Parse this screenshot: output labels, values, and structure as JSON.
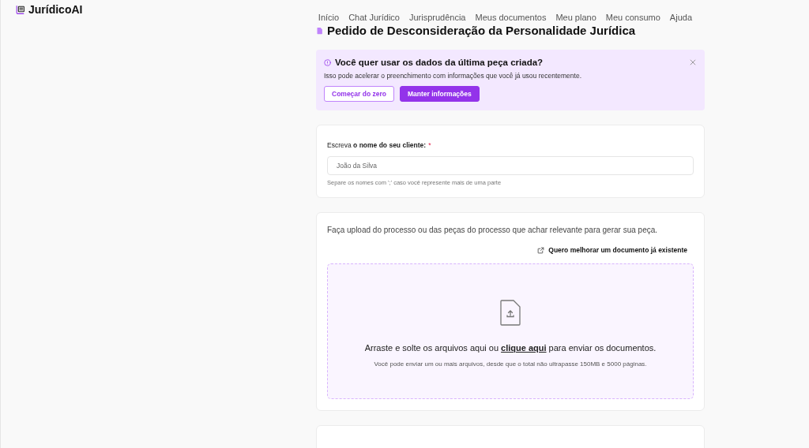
{
  "brand": {
    "name": "JurídicoAI"
  },
  "nav": [
    {
      "label": "Início"
    },
    {
      "label": "Chat Jurídico"
    },
    {
      "label": "Jurisprudência"
    },
    {
      "label": "Meus documentos"
    },
    {
      "label": "Meu plano"
    },
    {
      "label": "Meu consumo"
    },
    {
      "label": "Ajuda"
    }
  ],
  "page_title": "Pedido de Desconsideração da Personalidade Jurídica",
  "banner": {
    "title": "Você quer usar os dados da última peça criada?",
    "text": "Isso pode acelerar o preenchimento com informações que você já usou recentemente.",
    "buttons": [
      {
        "label": "Começar do zero",
        "kind": "outline"
      },
      {
        "label": "Manter informações",
        "kind": "primary"
      }
    ]
  },
  "client_field": {
    "label": "Escreva **o nome do seu cliente:**",
    "required_mark": "*",
    "placeholder": "João da Silva",
    "hint": "Separe os nomes com ';' caso você represente mais de uma parte"
  },
  "upload": {
    "intro": "Faça upload do processo ou das peças do processo que achar relevante para gerar sua peça.",
    "improve_link": "Quero melhorar um documento já existente",
    "drop_text_before": "Arraste e solte os arquivos aqui ou ",
    "drop_link": "clique aqui",
    "drop_text_after": " para enviar os documentos.",
    "limits": "Você pode enviar um ou mais arquivos, desde que o total não ultrapasse 150MB e 5000 páginas."
  }
}
